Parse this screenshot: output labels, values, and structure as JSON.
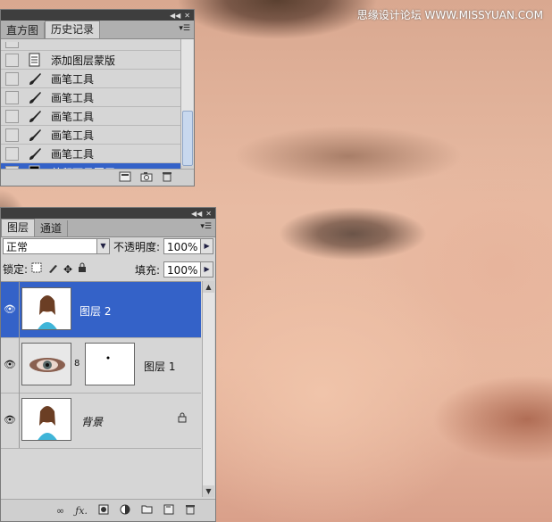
{
  "watermark": "思缘设计论坛 WWW.MISSYUAN.COM",
  "history_panel": {
    "tabs": [
      "直方图",
      "历史记录"
    ],
    "active_tab": 1,
    "items": [
      {
        "label": "添加图层蒙版",
        "icon": "document-icon"
      },
      {
        "label": "画笔工具",
        "icon": "brush-icon"
      },
      {
        "label": "画笔工具",
        "icon": "brush-icon"
      },
      {
        "label": "画笔工具",
        "icon": "brush-icon"
      },
      {
        "label": "画笔工具",
        "icon": "brush-icon"
      },
      {
        "label": "画笔工具",
        "icon": "brush-icon"
      },
      {
        "label": "盖印可见图层",
        "icon": "document-icon",
        "selected": true
      }
    ],
    "footer_icons": [
      "new-document-icon",
      "camera-icon",
      "trash-icon"
    ]
  },
  "layers_panel": {
    "tabs": [
      "图层",
      "通道"
    ],
    "active_tab": 0,
    "blend_mode": "正常",
    "opacity_label": "不透明度:",
    "opacity_value": "100%",
    "lock_label": "锁定:",
    "fill_label": "填充:",
    "fill_value": "100%",
    "layers": [
      {
        "name": "图层 2",
        "selected": true,
        "visible": true
      },
      {
        "name": "图层 1",
        "selected": false,
        "visible": true,
        "has_mask": true
      },
      {
        "name": "背景",
        "selected": false,
        "visible": true,
        "locked": true
      }
    ],
    "footer_icons": [
      "link-icon",
      "fx-icon",
      "mask-icon",
      "adjustment-icon",
      "folder-icon",
      "new-layer-icon",
      "trash-icon"
    ]
  },
  "colors": {
    "selection": "#3462c8",
    "panel_bg": "#d6d6d6"
  }
}
